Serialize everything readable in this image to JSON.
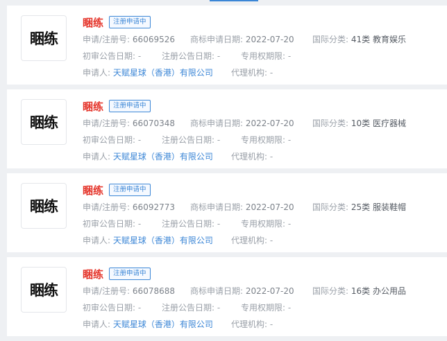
{
  "labels": {
    "reg_no": "申请/注册号:",
    "apply_date": "商标申请日期:",
    "intl_class": "国际分类:",
    "prelim_date": "初审公告日期:",
    "reg_date": "注册公告日期:",
    "exclusive_period": "专用权期限:",
    "applicant": "申请人:",
    "agency": "代理机构:"
  },
  "trademarks": [
    {
      "logo_text": "睏练",
      "name": "睏练",
      "status": "注册申请中",
      "reg_no": "66069526",
      "apply_date": "2022-07-20",
      "intl_class": "41类 教育娱乐",
      "prelim_date": "-",
      "reg_date": "-",
      "exclusive_period": "-",
      "applicant": "天赋星球（香港）有限公司",
      "agency": "-"
    },
    {
      "logo_text": "睏练",
      "name": "睏练",
      "status": "注册申请中",
      "reg_no": "66070348",
      "apply_date": "2022-07-20",
      "intl_class": "10类 医疗器械",
      "prelim_date": "-",
      "reg_date": "-",
      "exclusive_period": "-",
      "applicant": "天赋星球（香港）有限公司",
      "agency": "-"
    },
    {
      "logo_text": "睏练",
      "name": "睏练",
      "status": "注册申请中",
      "reg_no": "66092773",
      "apply_date": "2022-07-20",
      "intl_class": "25类 服装鞋帽",
      "prelim_date": "-",
      "reg_date": "-",
      "exclusive_period": "-",
      "applicant": "天赋星球（香港）有限公司",
      "agency": "-"
    },
    {
      "logo_text": "睏练",
      "name": "睏练",
      "status": "注册申请中",
      "reg_no": "66078688",
      "apply_date": "2022-07-20",
      "intl_class": "16类 办公用品",
      "prelim_date": "-",
      "reg_date": "-",
      "exclusive_period": "-",
      "applicant": "天赋星球（香港）有限公司",
      "agency": "-"
    }
  ]
}
